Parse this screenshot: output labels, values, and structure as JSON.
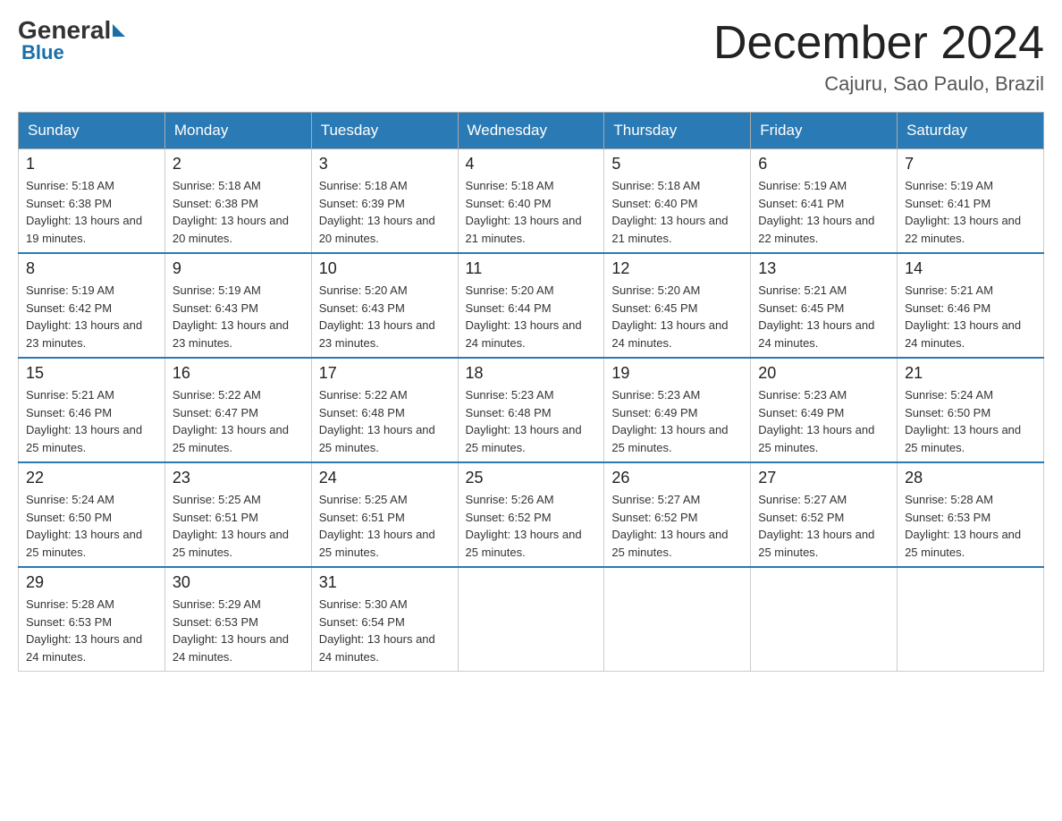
{
  "logo": {
    "general": "General",
    "blue": "Blue"
  },
  "title": "December 2024",
  "location": "Cajuru, Sao Paulo, Brazil",
  "headers": [
    "Sunday",
    "Monday",
    "Tuesday",
    "Wednesday",
    "Thursday",
    "Friday",
    "Saturday"
  ],
  "weeks": [
    [
      {
        "day": "1",
        "sunrise": "5:18 AM",
        "sunset": "6:38 PM",
        "daylight": "13 hours and 19 minutes."
      },
      {
        "day": "2",
        "sunrise": "5:18 AM",
        "sunset": "6:38 PM",
        "daylight": "13 hours and 20 minutes."
      },
      {
        "day": "3",
        "sunrise": "5:18 AM",
        "sunset": "6:39 PM",
        "daylight": "13 hours and 20 minutes."
      },
      {
        "day": "4",
        "sunrise": "5:18 AM",
        "sunset": "6:40 PM",
        "daylight": "13 hours and 21 minutes."
      },
      {
        "day": "5",
        "sunrise": "5:18 AM",
        "sunset": "6:40 PM",
        "daylight": "13 hours and 21 minutes."
      },
      {
        "day": "6",
        "sunrise": "5:19 AM",
        "sunset": "6:41 PM",
        "daylight": "13 hours and 22 minutes."
      },
      {
        "day": "7",
        "sunrise": "5:19 AM",
        "sunset": "6:41 PM",
        "daylight": "13 hours and 22 minutes."
      }
    ],
    [
      {
        "day": "8",
        "sunrise": "5:19 AM",
        "sunset": "6:42 PM",
        "daylight": "13 hours and 23 minutes."
      },
      {
        "day": "9",
        "sunrise": "5:19 AM",
        "sunset": "6:43 PM",
        "daylight": "13 hours and 23 minutes."
      },
      {
        "day": "10",
        "sunrise": "5:20 AM",
        "sunset": "6:43 PM",
        "daylight": "13 hours and 23 minutes."
      },
      {
        "day": "11",
        "sunrise": "5:20 AM",
        "sunset": "6:44 PM",
        "daylight": "13 hours and 24 minutes."
      },
      {
        "day": "12",
        "sunrise": "5:20 AM",
        "sunset": "6:45 PM",
        "daylight": "13 hours and 24 minutes."
      },
      {
        "day": "13",
        "sunrise": "5:21 AM",
        "sunset": "6:45 PM",
        "daylight": "13 hours and 24 minutes."
      },
      {
        "day": "14",
        "sunrise": "5:21 AM",
        "sunset": "6:46 PM",
        "daylight": "13 hours and 24 minutes."
      }
    ],
    [
      {
        "day": "15",
        "sunrise": "5:21 AM",
        "sunset": "6:46 PM",
        "daylight": "13 hours and 25 minutes."
      },
      {
        "day": "16",
        "sunrise": "5:22 AM",
        "sunset": "6:47 PM",
        "daylight": "13 hours and 25 minutes."
      },
      {
        "day": "17",
        "sunrise": "5:22 AM",
        "sunset": "6:48 PM",
        "daylight": "13 hours and 25 minutes."
      },
      {
        "day": "18",
        "sunrise": "5:23 AM",
        "sunset": "6:48 PM",
        "daylight": "13 hours and 25 minutes."
      },
      {
        "day": "19",
        "sunrise": "5:23 AM",
        "sunset": "6:49 PM",
        "daylight": "13 hours and 25 minutes."
      },
      {
        "day": "20",
        "sunrise": "5:23 AM",
        "sunset": "6:49 PM",
        "daylight": "13 hours and 25 minutes."
      },
      {
        "day": "21",
        "sunrise": "5:24 AM",
        "sunset": "6:50 PM",
        "daylight": "13 hours and 25 minutes."
      }
    ],
    [
      {
        "day": "22",
        "sunrise": "5:24 AM",
        "sunset": "6:50 PM",
        "daylight": "13 hours and 25 minutes."
      },
      {
        "day": "23",
        "sunrise": "5:25 AM",
        "sunset": "6:51 PM",
        "daylight": "13 hours and 25 minutes."
      },
      {
        "day": "24",
        "sunrise": "5:25 AM",
        "sunset": "6:51 PM",
        "daylight": "13 hours and 25 minutes."
      },
      {
        "day": "25",
        "sunrise": "5:26 AM",
        "sunset": "6:52 PM",
        "daylight": "13 hours and 25 minutes."
      },
      {
        "day": "26",
        "sunrise": "5:27 AM",
        "sunset": "6:52 PM",
        "daylight": "13 hours and 25 minutes."
      },
      {
        "day": "27",
        "sunrise": "5:27 AM",
        "sunset": "6:52 PM",
        "daylight": "13 hours and 25 minutes."
      },
      {
        "day": "28",
        "sunrise": "5:28 AM",
        "sunset": "6:53 PM",
        "daylight": "13 hours and 25 minutes."
      }
    ],
    [
      {
        "day": "29",
        "sunrise": "5:28 AM",
        "sunset": "6:53 PM",
        "daylight": "13 hours and 24 minutes."
      },
      {
        "day": "30",
        "sunrise": "5:29 AM",
        "sunset": "6:53 PM",
        "daylight": "13 hours and 24 minutes."
      },
      {
        "day": "31",
        "sunrise": "5:30 AM",
        "sunset": "6:54 PM",
        "daylight": "13 hours and 24 minutes."
      },
      null,
      null,
      null,
      null
    ]
  ]
}
